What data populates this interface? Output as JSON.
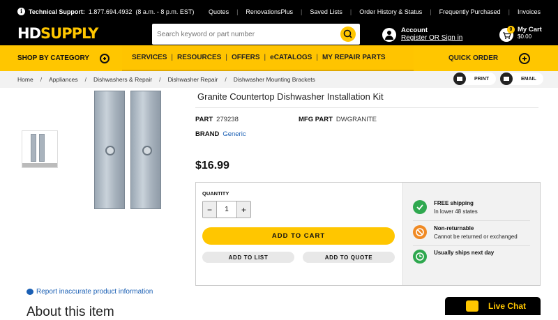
{
  "util": {
    "support_label": "Technical Support:",
    "support_phone": "1.877.694.4932",
    "support_hours": "(8 a.m. - 8 p.m. EST)",
    "links": [
      "Quotes",
      "RenovationsPlus",
      "Saved Lists",
      "Order History & Status",
      "Frequently Purchased",
      "Invoices"
    ]
  },
  "logo": {
    "hd": "HD",
    "supply": "SUPPLY"
  },
  "search": {
    "placeholder": "Search keyword or part number"
  },
  "account": {
    "title": "Account",
    "link": "Register OR Sign in"
  },
  "cart": {
    "title": "My Cart",
    "total": "$0.00",
    "count": "0"
  },
  "nav": {
    "shop_by_category": "SHOP BY CATEGORY",
    "links": [
      "SERVICES",
      "RESOURCES",
      "OFFERS",
      "eCATALOGS",
      "MY REPAIR PARTS"
    ],
    "quick_order": "QUICK ORDER"
  },
  "breadcrumb": [
    "Home",
    "Appliances",
    "Dishwashers & Repair",
    "Dishwasher Repair",
    "Dishwasher Mounting Brackets"
  ],
  "share": {
    "print": "PRINT",
    "email": "EMAIL"
  },
  "product": {
    "title": "Granite Countertop Dishwasher Installation Kit",
    "part_label": "PART",
    "part": "279238",
    "mfg_label": "MFG PART",
    "mfg": "DWGRANITE",
    "brand_label": "BRAND",
    "brand": "Generic",
    "price": "$16.99"
  },
  "buy": {
    "quantity_label": "QUANTITY",
    "quantity": "1",
    "minus": "−",
    "plus": "+",
    "add_to_cart": "ADD TO CART",
    "add_to_list": "ADD TO LIST",
    "add_to_quote": "ADD TO QUOTE"
  },
  "features": [
    {
      "title": "FREE shipping",
      "sub": "In lower 48 states",
      "color": "#2fa84f"
    },
    {
      "title": "Non-returnable",
      "sub": "Cannot be returned or exchanged",
      "color": "#f08a24"
    },
    {
      "title": "Usually ships next day",
      "sub": "",
      "color": "#2fa84f"
    }
  ],
  "report": "Report inaccurate product information",
  "about": "About this item",
  "chat": "Live Chat",
  "colors": {
    "brand_yellow": "#ffc600",
    "header_black": "#000000",
    "link_blue": "#1a5fb4"
  }
}
